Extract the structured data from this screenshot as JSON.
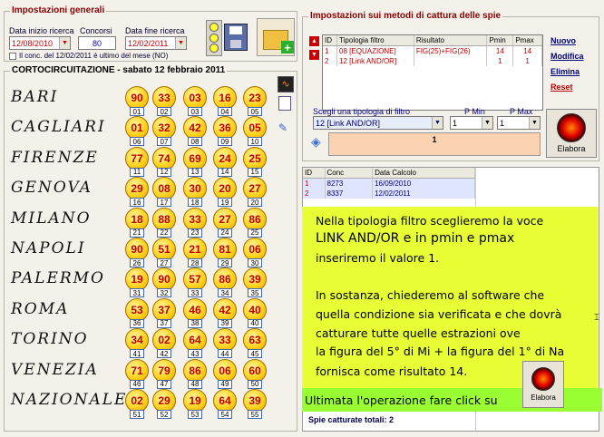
{
  "general": {
    "title": "Impostazioni generali",
    "start_label": "Data inizio ricerca",
    "start_value": "12/08/2010",
    "concorsi_label": "Concorsi",
    "concorsi_value": "80",
    "end_label": "Data fine ricerca",
    "end_value": "12/02/2011",
    "checkbox_label": "Il conc. del 12/02/2011 è ultimo del mese (NO)"
  },
  "draw_title": "CORTOCIRCUITAZIONE - sabato 12 febbraio 2011",
  "wheels": [
    {
      "name": "BARI",
      "balls": [
        "90",
        "33",
        "03",
        "16",
        "23"
      ],
      "pos": [
        "01",
        "02",
        "03",
        "04",
        "05"
      ]
    },
    {
      "name": "CAGLIARI",
      "balls": [
        "01",
        "32",
        "42",
        "36",
        "05"
      ],
      "pos": [
        "06",
        "07",
        "08",
        "09",
        "10"
      ]
    },
    {
      "name": "FIRENZE",
      "balls": [
        "77",
        "74",
        "69",
        "24",
        "25"
      ],
      "pos": [
        "11",
        "12",
        "13",
        "14",
        "15"
      ]
    },
    {
      "name": "GENOVA",
      "balls": [
        "29",
        "08",
        "30",
        "20",
        "27"
      ],
      "pos": [
        "16",
        "17",
        "18",
        "19",
        "20"
      ]
    },
    {
      "name": "MILANO",
      "balls": [
        "18",
        "88",
        "33",
        "27",
        "86"
      ],
      "pos": [
        "21",
        "22",
        "23",
        "24",
        "25"
      ]
    },
    {
      "name": "NAPOLI",
      "balls": [
        "90",
        "51",
        "21",
        "81",
        "06"
      ],
      "pos": [
        "26",
        "27",
        "28",
        "29",
        "30"
      ]
    },
    {
      "name": "PALERMO",
      "balls": [
        "19",
        "90",
        "57",
        "86",
        "39"
      ],
      "pos": [
        "31",
        "32",
        "33",
        "34",
        "35"
      ]
    },
    {
      "name": "ROMA",
      "balls": [
        "53",
        "37",
        "46",
        "42",
        "40"
      ],
      "pos": [
        "36",
        "37",
        "38",
        "39",
        "40"
      ]
    },
    {
      "name": "TORINO",
      "balls": [
        "34",
        "02",
        "64",
        "33",
        "63"
      ],
      "pos": [
        "41",
        "42",
        "43",
        "44",
        "45"
      ]
    },
    {
      "name": "VENEZIA",
      "balls": [
        "71",
        "79",
        "86",
        "06",
        "60"
      ],
      "pos": [
        "46",
        "47",
        "48",
        "49",
        "50"
      ]
    },
    {
      "name": "NAZIONALE",
      "balls": [
        "02",
        "29",
        "19",
        "64",
        "39"
      ],
      "pos": [
        "51",
        "52",
        "53",
        "54",
        "55"
      ]
    }
  ],
  "methods": {
    "title": "Impostazioni sui metodi di cattura delle spie",
    "headers": [
      "ID",
      "Tipologia filtro",
      "Risultato",
      "Pmin",
      "Pmax"
    ],
    "rows": [
      [
        "1",
        "08 [EQUAZIONE]",
        "FIG(25)+FIG(26)",
        "14",
        "14"
      ],
      [
        "2",
        "12 [Link AND/OR]",
        "",
        "1",
        "1"
      ]
    ],
    "links": [
      "Nuovo",
      "Modifica",
      "Elimina",
      "Reset"
    ],
    "filter_label": "Scegli una tipologia di filtro",
    "filter_value": "12 [Link AND/OR]",
    "pmin_label": "P Min",
    "pmin_value": "1",
    "pmax_label": "P Max",
    "pmax_value": "1",
    "formula_value": "1",
    "elabora": "Elabora"
  },
  "results": {
    "headers": [
      "ID",
      "Conc",
      "Data Calcolo"
    ],
    "rows": [
      [
        "1",
        "8273",
        "16/09/2010"
      ],
      [
        "2",
        "8337",
        "12/02/2011"
      ]
    ],
    "footer": "Spie catturate totali: 2"
  },
  "note": {
    "lines": [
      "Nella tipologia filtro sceglieremo la voce",
      "LINK AND/OR e in pmin e pmax",
      "inseriremo il valore 1.",
      "In sostanza, chiederemo al software che",
      "quella condizione sia verificata e che dovrà",
      "catturare tutte quelle estrazioni ove",
      "la figura del 5° di Mi + la figura del 1° di Na",
      "fornisca come risultato 14."
    ],
    "callout": "Ultimata l'operazione fare click su",
    "elabora": "Elabora"
  },
  "colors": {
    "ball": "#ffd21a",
    "number": "#c00000",
    "note_bg": "#e8ff36",
    "callout_bg": "#99ff33"
  }
}
